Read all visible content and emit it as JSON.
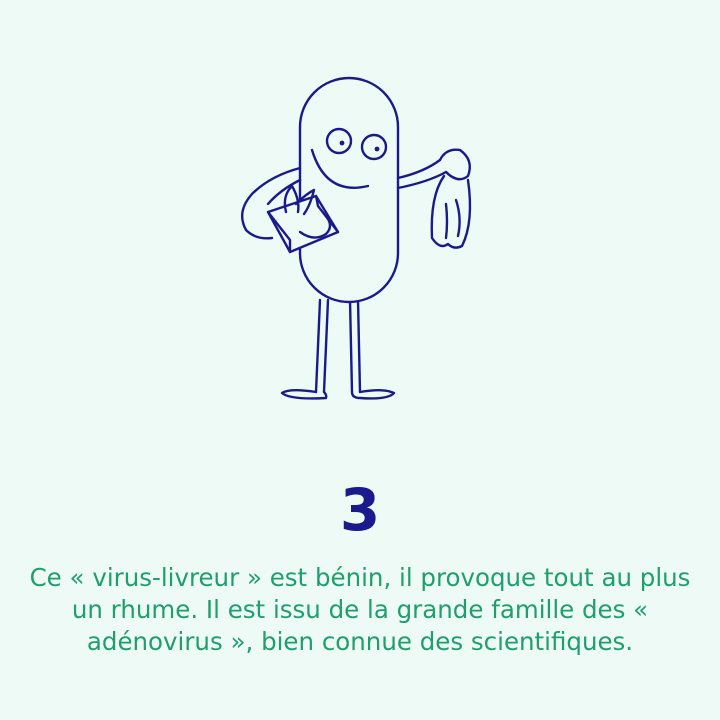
{
  "step": {
    "number": "3"
  },
  "caption": {
    "text": "Ce « virus-livreur » est bénin, il provoque tout au plus un rhume. Il est issu de la grande famille des « adénovirus », bien connue des scientifiques."
  },
  "illustration": {
    "icon": "virus-character-with-tissues-icon"
  },
  "colors": {
    "background": "#eefaf5",
    "ink": "#1a1a8c",
    "caption": "#1f9e6e"
  }
}
